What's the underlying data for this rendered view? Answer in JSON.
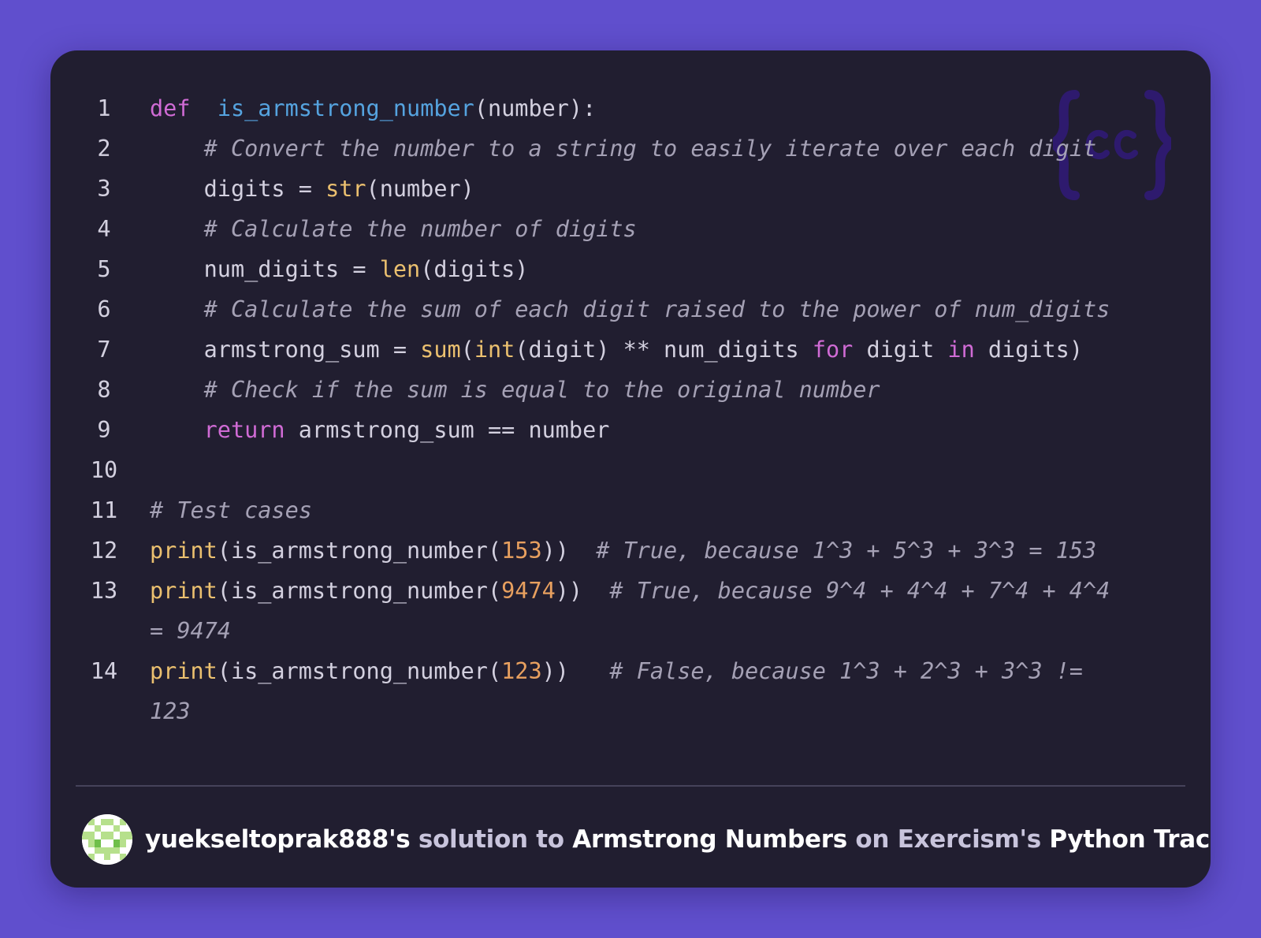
{
  "colors": {
    "background": "#604fcd",
    "card": "#211e30",
    "keyword": "#d06bd5",
    "function": "#55a3df",
    "builtin": "#ebc06f",
    "number": "#e8a05f",
    "comment": "#a5a1b5",
    "text": "#d3d0df"
  },
  "logo": {
    "icon": "exercism-curly-braces-logo"
  },
  "code": {
    "line_numbers": [
      "1",
      "2",
      "3",
      "4",
      "5",
      "6",
      "7",
      "8",
      "9",
      "10",
      "11",
      "12",
      "13",
      "14"
    ],
    "lines": [
      {
        "n": 0,
        "tokens": [
          [
            "kw",
            "def"
          ],
          [
            "",
            "  "
          ],
          [
            "fn",
            "is_armstrong_number"
          ],
          [
            "",
            "(number):"
          ]
        ]
      },
      {
        "n": 1,
        "tokens": [
          [
            "",
            "    "
          ],
          [
            "cm",
            "# Convert the number to a string to easily iterate over each digit"
          ]
        ]
      },
      {
        "n": 2,
        "tokens": [
          [
            "",
            "    digits = "
          ],
          [
            "bi",
            "str"
          ],
          [
            "",
            "(number)"
          ]
        ]
      },
      {
        "n": 3,
        "tokens": [
          [
            "",
            "    "
          ],
          [
            "cm",
            "# Calculate the number of digits"
          ]
        ]
      },
      {
        "n": 4,
        "tokens": [
          [
            "",
            "    num_digits = "
          ],
          [
            "bi",
            "len"
          ],
          [
            "",
            "(digits)"
          ]
        ]
      },
      {
        "n": 5,
        "tokens": [
          [
            "",
            "    "
          ],
          [
            "cm",
            "# Calculate the sum of each digit raised to the power of num_digits"
          ]
        ]
      },
      {
        "n": 6,
        "tokens": [
          [
            "",
            "    armstrong_sum = "
          ],
          [
            "bi",
            "sum"
          ],
          [
            "",
            "("
          ],
          [
            "bi",
            "int"
          ],
          [
            "",
            "(digit) ** num_digits "
          ],
          [
            "kw",
            "for"
          ],
          [
            "",
            " digit "
          ],
          [
            "kw",
            "in"
          ],
          [
            "",
            " digits)"
          ]
        ]
      },
      {
        "n": 7,
        "tokens": [
          [
            "",
            "    "
          ],
          [
            "cm",
            "# Check if the sum is equal to the original number"
          ]
        ]
      },
      {
        "n": 8,
        "tokens": [
          [
            "",
            "    "
          ],
          [
            "kw",
            "return"
          ],
          [
            "",
            " armstrong_sum == number"
          ]
        ]
      },
      {
        "n": 9,
        "tokens": [
          [
            "",
            ""
          ]
        ]
      },
      {
        "n": 10,
        "tokens": [
          [
            "cm",
            "# Test cases"
          ]
        ]
      },
      {
        "n": 11,
        "tokens": [
          [
            "bi",
            "print"
          ],
          [
            "",
            "(is_armstrong_number("
          ],
          [
            "num",
            "153"
          ],
          [
            "",
            "))  "
          ],
          [
            "cm",
            "# True, because 1^3 + 5^3 + 3^3 = 153"
          ]
        ]
      },
      {
        "n": 12,
        "tokens": [
          [
            "bi",
            "print"
          ],
          [
            "",
            "(is_armstrong_number("
          ],
          [
            "num",
            "9474"
          ],
          [
            "",
            "))  "
          ],
          [
            "cm",
            "# True, because 9^4 + 4^4 + 7^4 + 4^4"
          ]
        ]
      },
      {
        "n": null,
        "tokens": [
          [
            "cm",
            "= 9474"
          ]
        ]
      },
      {
        "n": 13,
        "tokens": [
          [
            "bi",
            "print"
          ],
          [
            "",
            "(is_armstrong_number("
          ],
          [
            "num",
            "123"
          ],
          [
            "",
            "))   "
          ],
          [
            "cm",
            "# False, because 1^3 + 2^3 + 3^3 !="
          ]
        ]
      },
      {
        "n": null,
        "tokens": [
          [
            "cm",
            "123"
          ]
        ]
      }
    ]
  },
  "footer": {
    "avatar_icon": "user-avatar-identicon",
    "username": "yuekseltoprak888",
    "possessive": "'s",
    "solution_to": " solution to ",
    "exercise": "Armstrong Numbers",
    "on": " on ",
    "platform": "Exercism",
    "platform_possessive": "'s",
    "track": " Python Track."
  }
}
